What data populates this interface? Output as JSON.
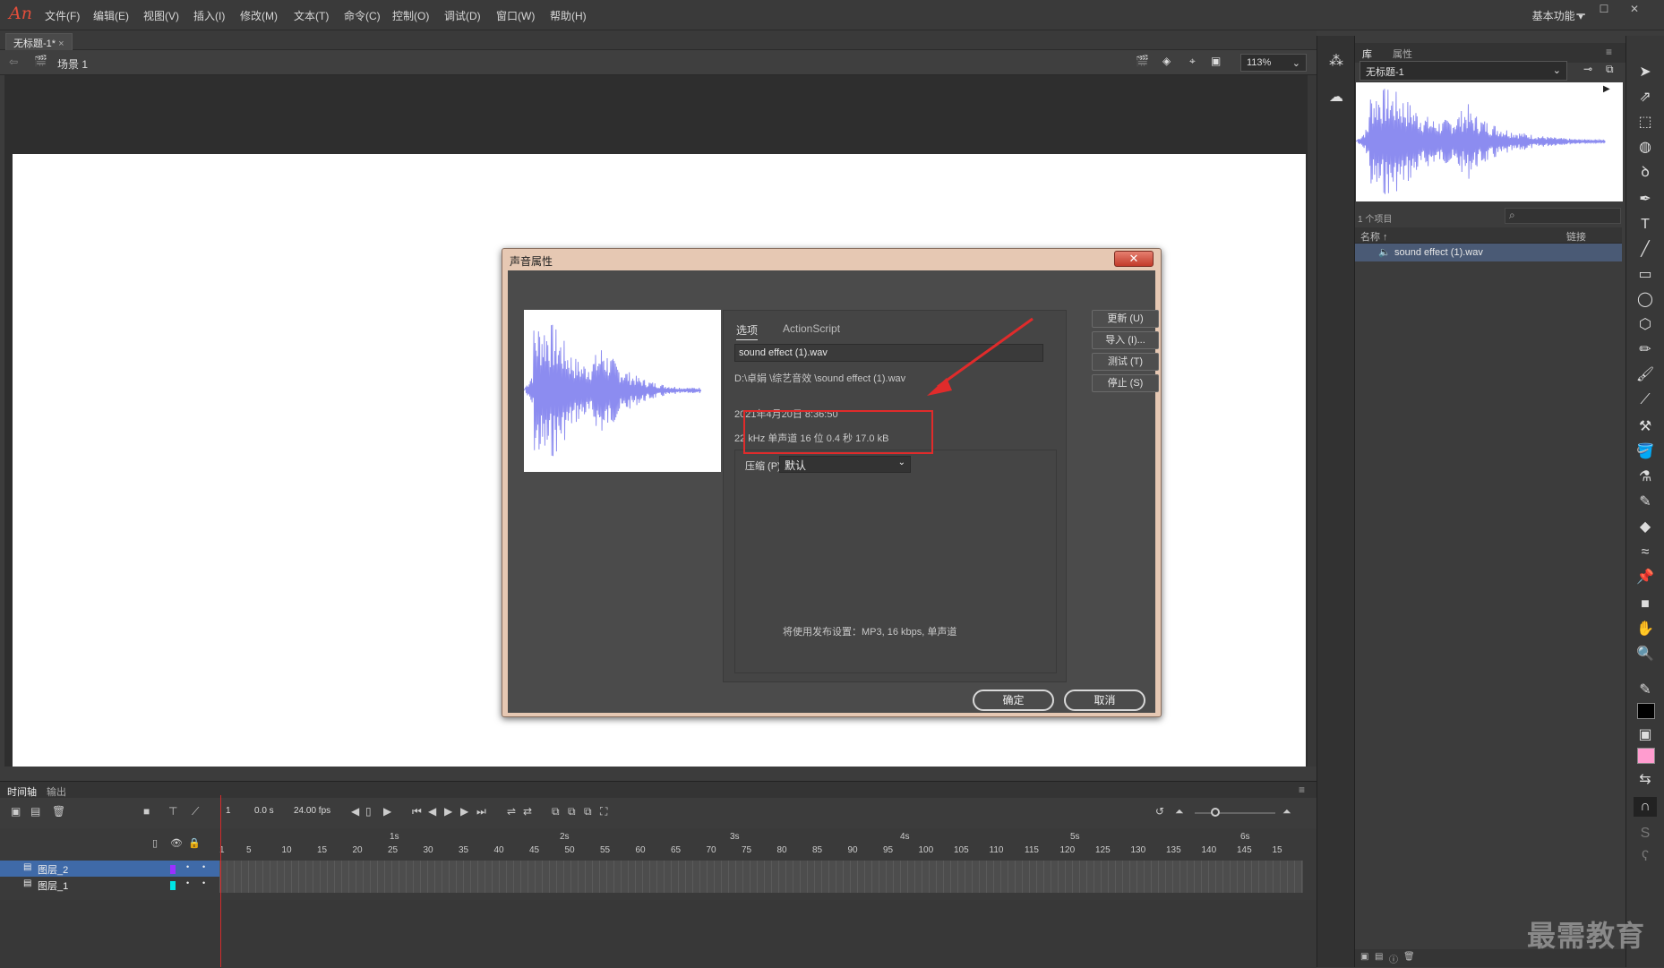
{
  "app": {
    "logo": "An"
  },
  "menu": [
    "文件(F)",
    "编辑(E)",
    "视图(V)",
    "插入(I)",
    "修改(M)",
    "文本(T)",
    "命令(C)",
    "控制(O)",
    "调试(D)",
    "窗口(W)",
    "帮助(H)"
  ],
  "workspace": {
    "label": "基本功能"
  },
  "document": {
    "tab": "无标题-1*",
    "tab_close": "×"
  },
  "scene": {
    "label": "场景 1",
    "zoom": "113%"
  },
  "library": {
    "tab_library": "库",
    "tab_properties": "属性",
    "doc_select": "无标题-1",
    "count": "1 个项目",
    "col_name": "名称 ↑",
    "col_link": "链接",
    "item": "sound effect (1).wav"
  },
  "timeline": {
    "tab_timeline": "时间轴",
    "tab_output": "输出",
    "frame": "1",
    "time": "0.0 s",
    "fps": "24.00 fps",
    "seconds": [
      "1s",
      "2s",
      "3s",
      "4s",
      "5s",
      "6s"
    ],
    "frame_ticks": [
      "1",
      "5",
      "10",
      "15",
      "20",
      "25",
      "30",
      "35",
      "40",
      "45",
      "50",
      "55",
      "60",
      "65",
      "70",
      "75",
      "80",
      "85",
      "90",
      "95",
      "100",
      "105",
      "110",
      "115",
      "120",
      "125",
      "130",
      "135",
      "140",
      "145",
      "15"
    ],
    "layers": [
      {
        "name": "图层_2",
        "color": "#9b30ff",
        "selected": true
      },
      {
        "name": "图层_1",
        "color": "#00e5e5",
        "selected": false
      }
    ]
  },
  "dialog": {
    "title": "声音属性",
    "close": "✕",
    "tab_options": "选项",
    "tab_actionscript": "ActionScript",
    "filename": "sound effect (1).wav",
    "path": "D:\\卓娟 \\综艺音效 \\sound effect (1).wav",
    "date": "2021年4月20日   8:36:50",
    "info": "22 kHz 单声道 16 位 0.4 秒 17.0 kB",
    "compression_label": "压缩 (P):",
    "compression_value": "默认",
    "publish_note": "将使用发布设置：MP3, 16 kbps, 单声道",
    "buttons": {
      "update": "更新 (U)",
      "import": "导入 (I)...",
      "test": "测试 (T)",
      "stop": "停止 (S)"
    },
    "ok": "确定",
    "cancel": "取消"
  },
  "colors": {
    "highlight": "#e02b2b",
    "waveform": "#8c8cf0",
    "selected_layer": "#3f6aa8"
  },
  "watermark": "最需教育"
}
